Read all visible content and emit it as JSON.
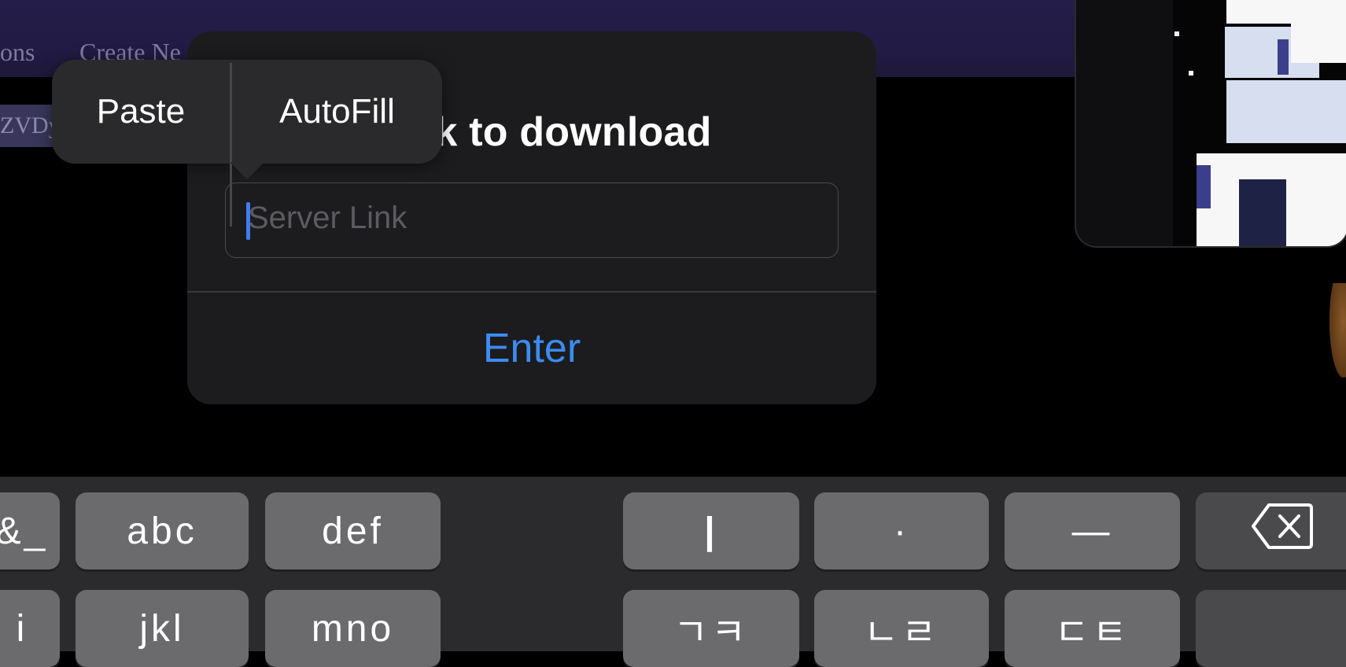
{
  "background_page": {
    "tabs": [
      "ons",
      "Create Ne"
    ],
    "chip_text": "ZVDy"
  },
  "dialog": {
    "title": "e link to download",
    "input": {
      "placeholder": "Server Link",
      "value": ""
    },
    "enter_label": "Enter"
  },
  "edit_menu": {
    "items": [
      "Paste",
      "AutoFill"
    ]
  },
  "keyboard": {
    "row1": [
      "&_",
      "abc",
      "def",
      "|",
      "·",
      "—"
    ],
    "row2": [
      "i",
      "jkl",
      "mno",
      "ㄱㅋ",
      "ㄴㄹ",
      "ㄷㅌ"
    ],
    "backspace_icon": "backspace-icon"
  },
  "colors": {
    "accent": "#3c8cf4",
    "dialog_bg": "#1c1c1e",
    "header_bg": "#221b45",
    "key_bg": "#6b6b6e"
  }
}
